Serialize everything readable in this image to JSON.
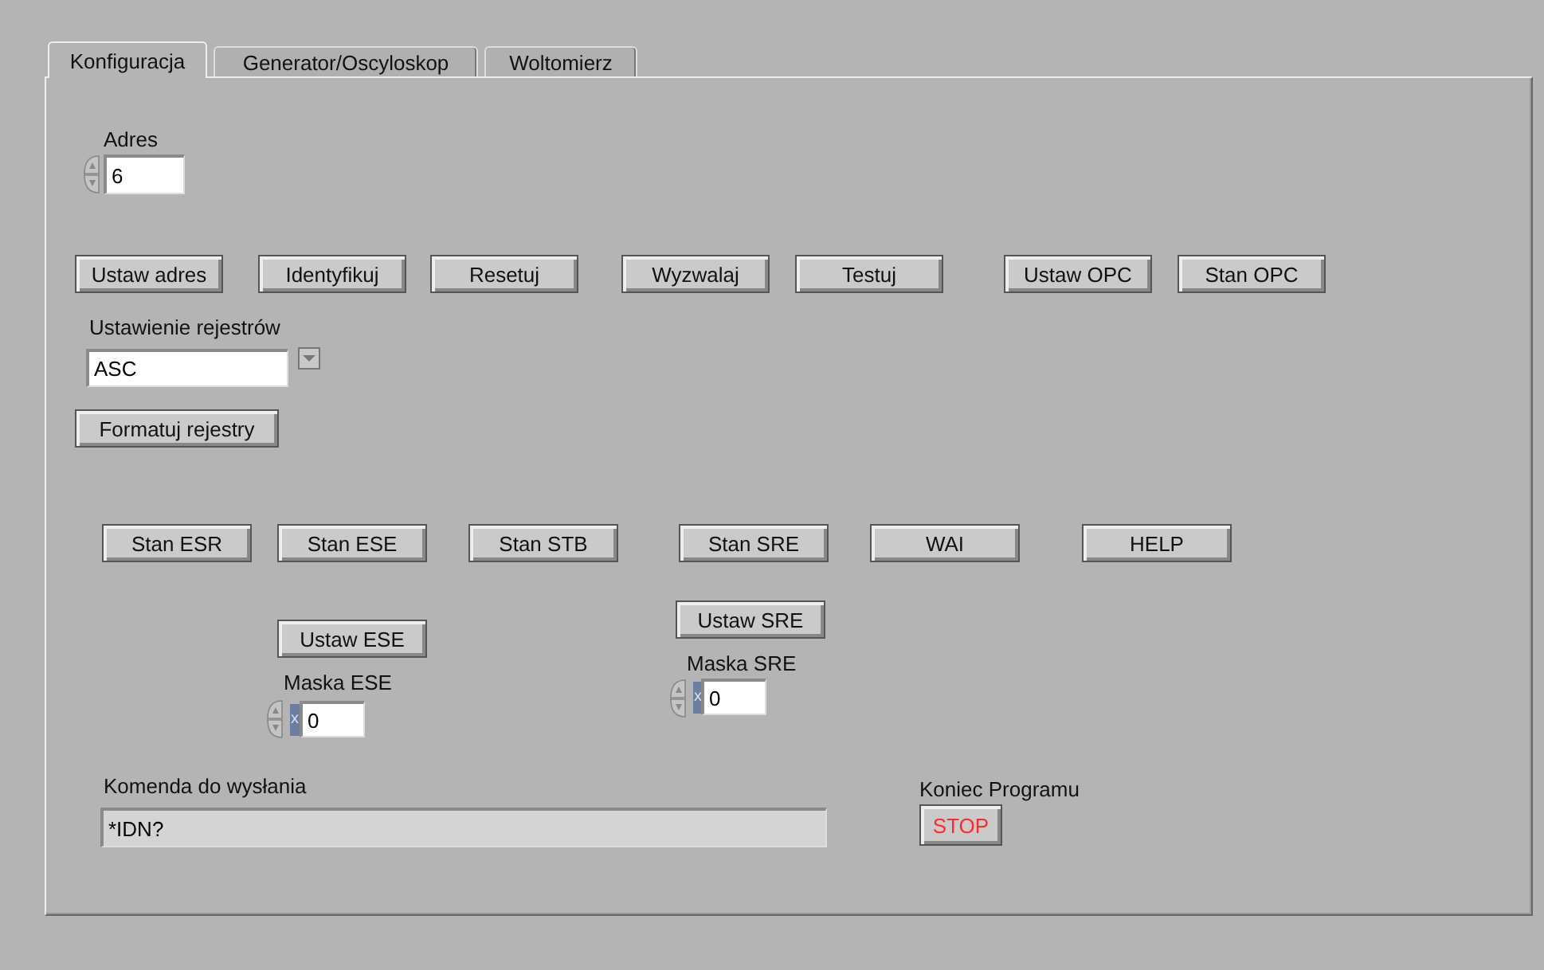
{
  "tabs": [
    {
      "label": "Konfiguracja",
      "selected": true
    },
    {
      "label": "Generator/Oscyloskop",
      "selected": false
    },
    {
      "label": "Woltomierz",
      "selected": false
    }
  ],
  "address": {
    "label": "Adres",
    "value": "6"
  },
  "top_buttons": [
    "Ustaw adres",
    "Identyfikuj",
    "Resetuj",
    "Wyzwalaj",
    "Testuj",
    "Ustaw OPC",
    "Stan OPC"
  ],
  "register_setting": {
    "label": "Ustawienie rejestrów",
    "value": "ASC"
  },
  "format_button": "Formatuj  rejestry",
  "status_buttons": [
    "Stan ESR",
    "Stan ESE",
    "Stan STB",
    "Stan SRE",
    "WAI",
    "HELP"
  ],
  "ese": {
    "button": "Ustaw ESE",
    "label": "Maska ESE",
    "radix": "x",
    "value": "0"
  },
  "sre": {
    "button": "Ustaw SRE",
    "label": "Maska SRE",
    "radix": "x",
    "value": "0"
  },
  "command": {
    "label": "Komenda do wysłania",
    "value": "*IDN?"
  },
  "stop": {
    "label": "Koniec Programu",
    "button": "STOP"
  }
}
